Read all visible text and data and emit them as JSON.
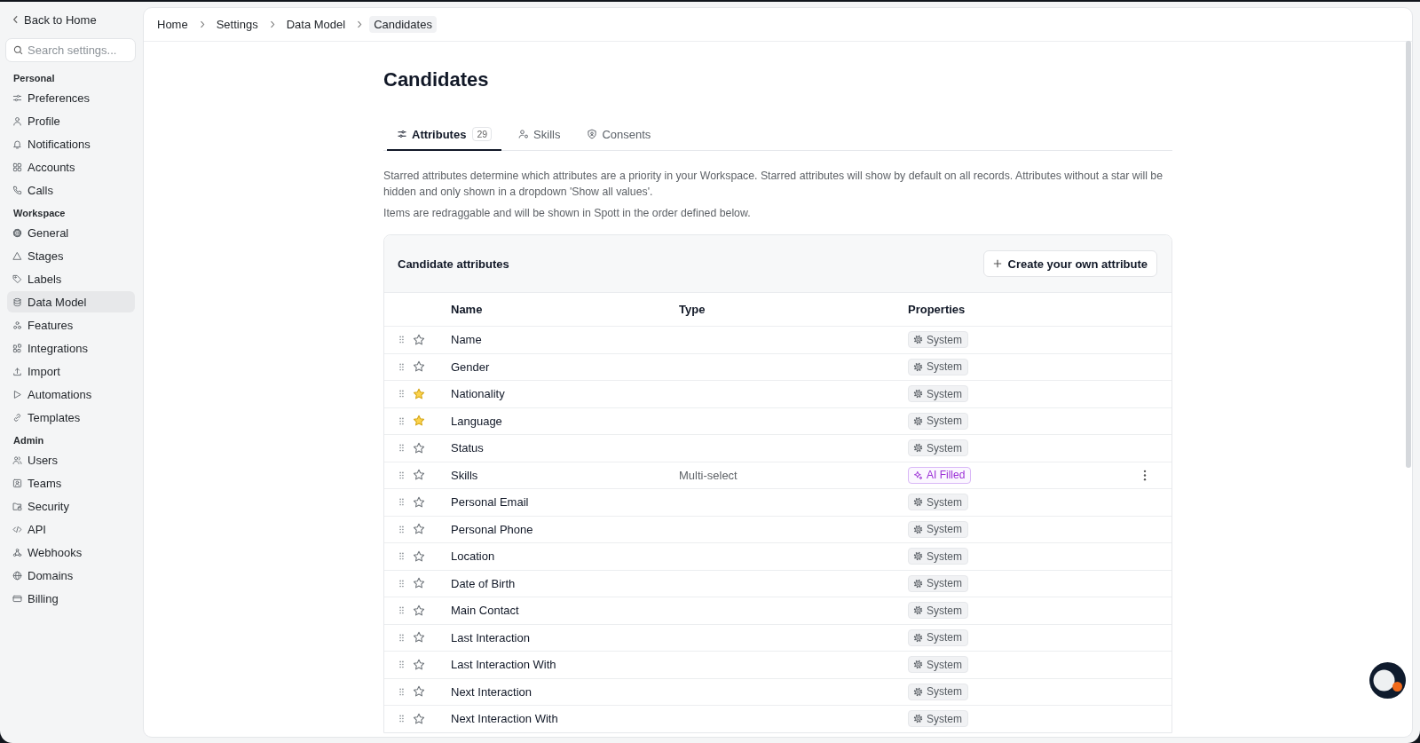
{
  "sidebar": {
    "back_link": "Back to Home",
    "search": {
      "placeholder": "Search settings..."
    },
    "sections": [
      {
        "title": "Personal",
        "items": [
          {
            "label": "Preferences",
            "selected": false
          },
          {
            "label": "Profile",
            "selected": false
          },
          {
            "label": "Notifications",
            "selected": false
          },
          {
            "label": "Accounts",
            "selected": false
          },
          {
            "label": "Calls",
            "selected": false
          }
        ]
      },
      {
        "title": "Workspace",
        "items": [
          {
            "label": "General",
            "selected": false
          },
          {
            "label": "Stages",
            "selected": false
          },
          {
            "label": "Labels",
            "selected": false
          },
          {
            "label": "Data Model",
            "selected": true
          },
          {
            "label": "Features",
            "selected": false
          },
          {
            "label": "Integrations",
            "selected": false
          },
          {
            "label": "Import",
            "selected": false
          },
          {
            "label": "Automations",
            "selected": false
          },
          {
            "label": "Templates",
            "selected": false
          }
        ]
      },
      {
        "title": "Admin",
        "items": [
          {
            "label": "Users",
            "selected": false
          },
          {
            "label": "Teams",
            "selected": false
          },
          {
            "label": "Security",
            "selected": false
          },
          {
            "label": "API",
            "selected": false
          },
          {
            "label": "Webhooks",
            "selected": false
          },
          {
            "label": "Domains",
            "selected": false
          },
          {
            "label": "Billing",
            "selected": false
          }
        ]
      }
    ]
  },
  "breadcrumb": [
    {
      "label": "Home",
      "selected": false
    },
    {
      "label": "Settings",
      "selected": false
    },
    {
      "label": "Data Model",
      "selected": false
    },
    {
      "label": "Candidates",
      "selected": true
    }
  ],
  "page": {
    "title": "Candidates",
    "tabs": [
      {
        "label": "Attributes",
        "count": "29",
        "selected": true
      },
      {
        "label": "Skills",
        "selected": false
      },
      {
        "label": "Consents",
        "selected": false
      }
    ],
    "description": [
      "Starred attributes determine which attributes are a priority in your Workspace. Starred attributes will show by default on all records. Attributes without a star will be hidden and only shown in a dropdown 'Show all values'.",
      "Items are redraggable and will be shown in Spott in the order defined below."
    ],
    "card": {
      "title": "Candidate attributes",
      "create_button": "Create your own attribute",
      "columns": [
        "Name",
        "Type",
        "Properties"
      ],
      "rows": [
        {
          "name": "Name",
          "starred": false,
          "property": {
            "kind": "system",
            "label": "System"
          },
          "menu": false
        },
        {
          "name": "Gender",
          "starred": false,
          "property": {
            "kind": "system",
            "label": "System"
          },
          "menu": false
        },
        {
          "name": "Nationality",
          "starred": true,
          "property": {
            "kind": "system",
            "label": "System"
          },
          "menu": false
        },
        {
          "name": "Language",
          "starred": true,
          "property": {
            "kind": "system",
            "label": "System"
          },
          "menu": false
        },
        {
          "name": "Status",
          "starred": false,
          "property": {
            "kind": "system",
            "label": "System"
          },
          "menu": false
        },
        {
          "name": "Skills",
          "type": "Multi-select",
          "starred": false,
          "property": {
            "kind": "ai",
            "label": "AI Filled"
          },
          "menu": true
        },
        {
          "name": "Personal Email",
          "starred": false,
          "property": {
            "kind": "system",
            "label": "System"
          },
          "menu": false
        },
        {
          "name": "Personal Phone",
          "starred": false,
          "property": {
            "kind": "system",
            "label": "System"
          },
          "menu": false
        },
        {
          "name": "Location",
          "starred": false,
          "property": {
            "kind": "system",
            "label": "System"
          },
          "menu": false
        },
        {
          "name": "Date of Birth",
          "starred": false,
          "property": {
            "kind": "system",
            "label": "System"
          },
          "menu": false
        },
        {
          "name": "Main Contact",
          "starred": false,
          "property": {
            "kind": "system",
            "label": "System"
          },
          "menu": false
        },
        {
          "name": "Last Interaction",
          "starred": false,
          "property": {
            "kind": "system",
            "label": "System"
          },
          "menu": false
        },
        {
          "name": "Last Interaction With",
          "starred": false,
          "property": {
            "kind": "system",
            "label": "System"
          },
          "menu": false
        },
        {
          "name": "Next Interaction",
          "starred": false,
          "property": {
            "kind": "system",
            "label": "System"
          },
          "menu": false
        },
        {
          "name": "Next Interaction With",
          "starred": false,
          "property": {
            "kind": "system",
            "label": "System"
          },
          "menu": false
        }
      ]
    }
  }
}
